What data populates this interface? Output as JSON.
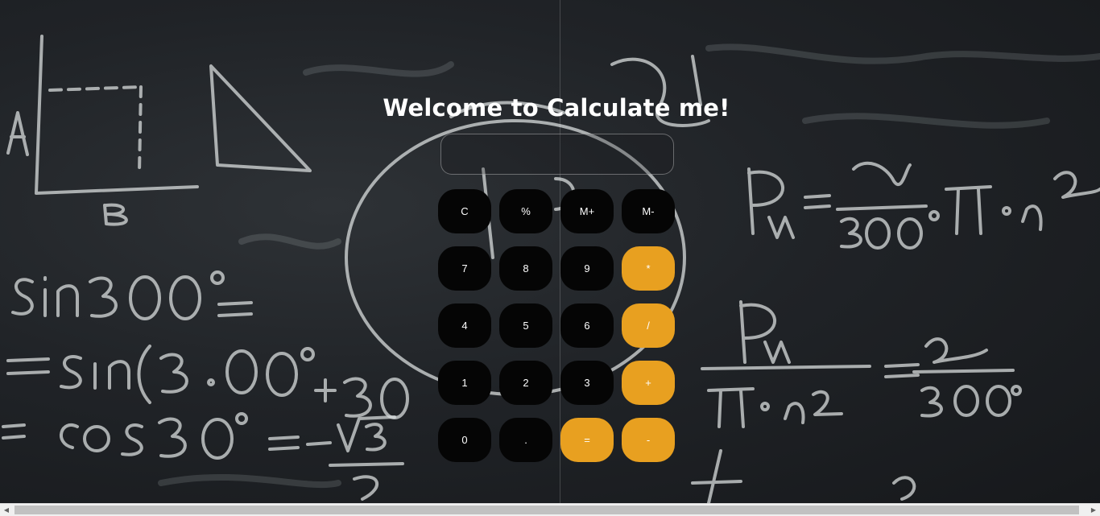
{
  "page": {
    "title": "Welcome to Calculate me!"
  },
  "calculator": {
    "display_value": "",
    "keys": [
      {
        "label": "C",
        "name": "clear-button",
        "type": "fn"
      },
      {
        "label": "%",
        "name": "percent-button",
        "type": "fn"
      },
      {
        "label": "M+",
        "name": "memory-add-button",
        "type": "fn"
      },
      {
        "label": "M-",
        "name": "memory-subtract-button",
        "type": "fn"
      },
      {
        "label": "7",
        "name": "digit-7-button",
        "type": "num"
      },
      {
        "label": "8",
        "name": "digit-8-button",
        "type": "num"
      },
      {
        "label": "9",
        "name": "digit-9-button",
        "type": "num"
      },
      {
        "label": "*",
        "name": "multiply-button",
        "type": "op"
      },
      {
        "label": "4",
        "name": "digit-4-button",
        "type": "num"
      },
      {
        "label": "5",
        "name": "digit-5-button",
        "type": "num"
      },
      {
        "label": "6",
        "name": "digit-6-button",
        "type": "num"
      },
      {
        "label": "/",
        "name": "divide-button",
        "type": "op"
      },
      {
        "label": "1",
        "name": "digit-1-button",
        "type": "num"
      },
      {
        "label": "2",
        "name": "digit-2-button",
        "type": "num"
      },
      {
        "label": "3",
        "name": "digit-3-button",
        "type": "num"
      },
      {
        "label": "+",
        "name": "add-button",
        "type": "op"
      },
      {
        "label": "0",
        "name": "digit-0-button",
        "type": "num"
      },
      {
        "label": ".",
        "name": "decimal-button",
        "type": "num"
      },
      {
        "label": "=",
        "name": "equals-button",
        "type": "op"
      },
      {
        "label": "-",
        "name": "subtract-button",
        "type": "op"
      }
    ]
  },
  "colors": {
    "key_dark": "#050505",
    "key_accent": "#e8a020",
    "text": "#ffffff"
  },
  "scrollbar": {
    "left_arrow_icon": "chevron-left-icon",
    "right_arrow_icon": "chevron-right-icon"
  }
}
